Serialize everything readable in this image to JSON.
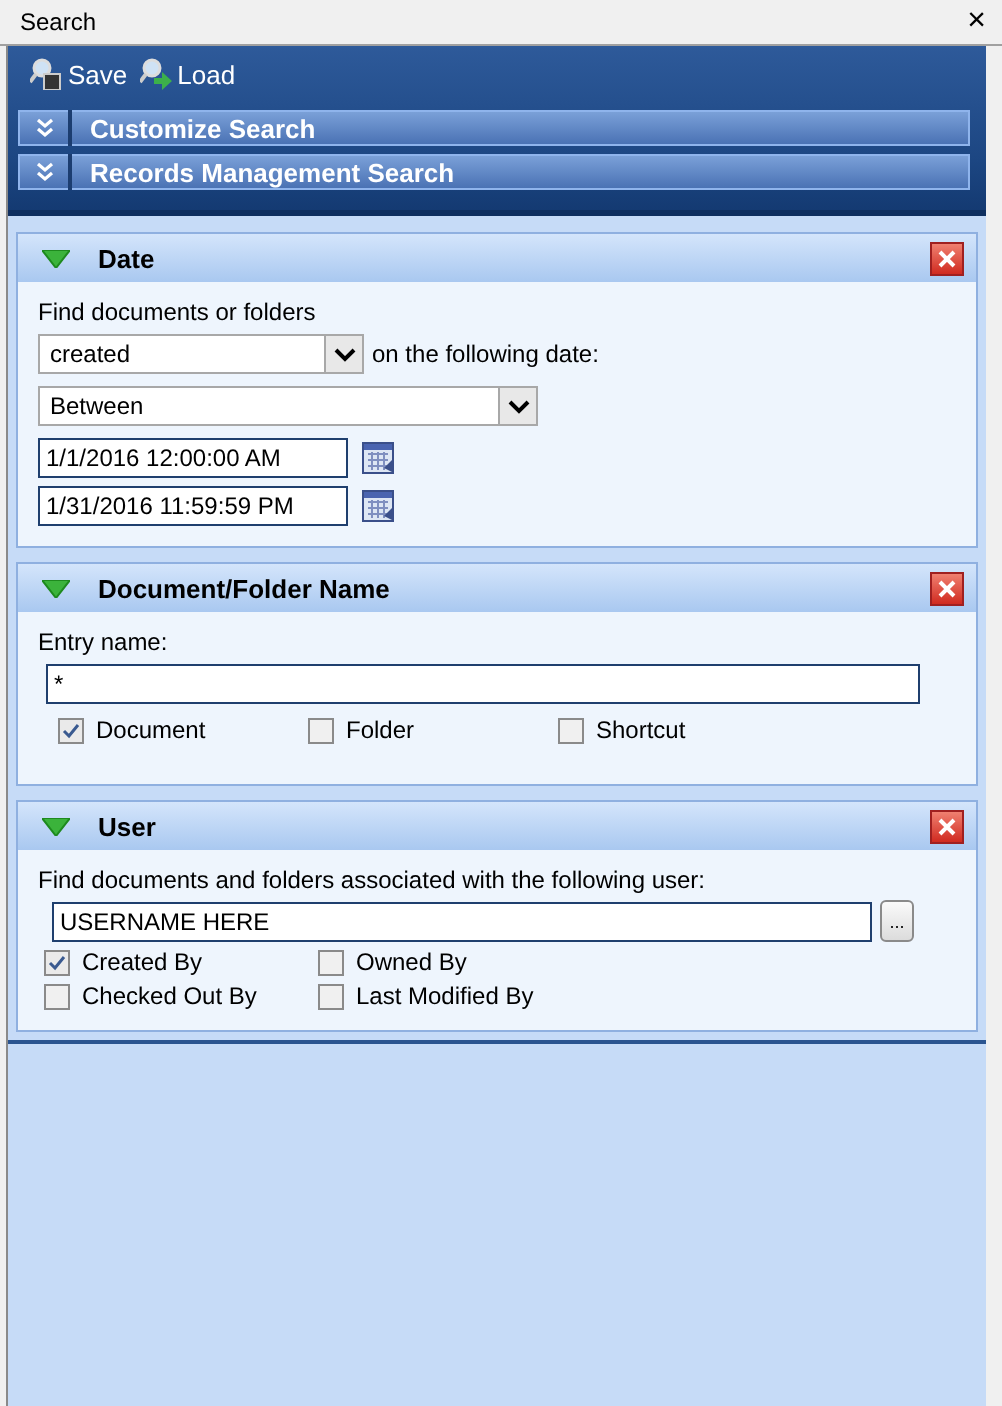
{
  "window": {
    "title": "Search",
    "close": "×"
  },
  "toolbar": [
    {
      "kind": "save",
      "label": "Save"
    },
    {
      "kind": "load",
      "label": "Load"
    }
  ],
  "sections": [
    {
      "label": "Customize Search",
      "expanded": false
    },
    {
      "label": "Records Management Search",
      "expanded": false
    }
  ],
  "panels": [
    {
      "kind": "date",
      "title": "Date",
      "expanded": true,
      "prompt": "Find documents or folders",
      "action": "created",
      "action_suffix": "on the following date:",
      "range": "Between",
      "from": "1/1/2016 12:00:00 AM",
      "to": "1/31/2016 11:59:59 PM"
    },
    {
      "kind": "name",
      "title": "Document/Folder Name",
      "expanded": true,
      "label": "Entry name:",
      "value": "*",
      "options": [
        {
          "label": "Document",
          "checked": true
        },
        {
          "label": "Folder",
          "checked": false
        },
        {
          "label": "Shortcut",
          "checked": false
        }
      ]
    },
    {
      "kind": "user",
      "title": "User",
      "expanded": true,
      "prompt": "Find documents and folders associated with the following user:",
      "value": "USERNAME HERE",
      "browse": "...",
      "options": [
        {
          "label": "Created By",
          "checked": true
        },
        {
          "label": "Owned By",
          "checked": false
        },
        {
          "label": "Checked Out By",
          "checked": false
        },
        {
          "label": "Last Modified By",
          "checked": false
        }
      ]
    }
  ]
}
